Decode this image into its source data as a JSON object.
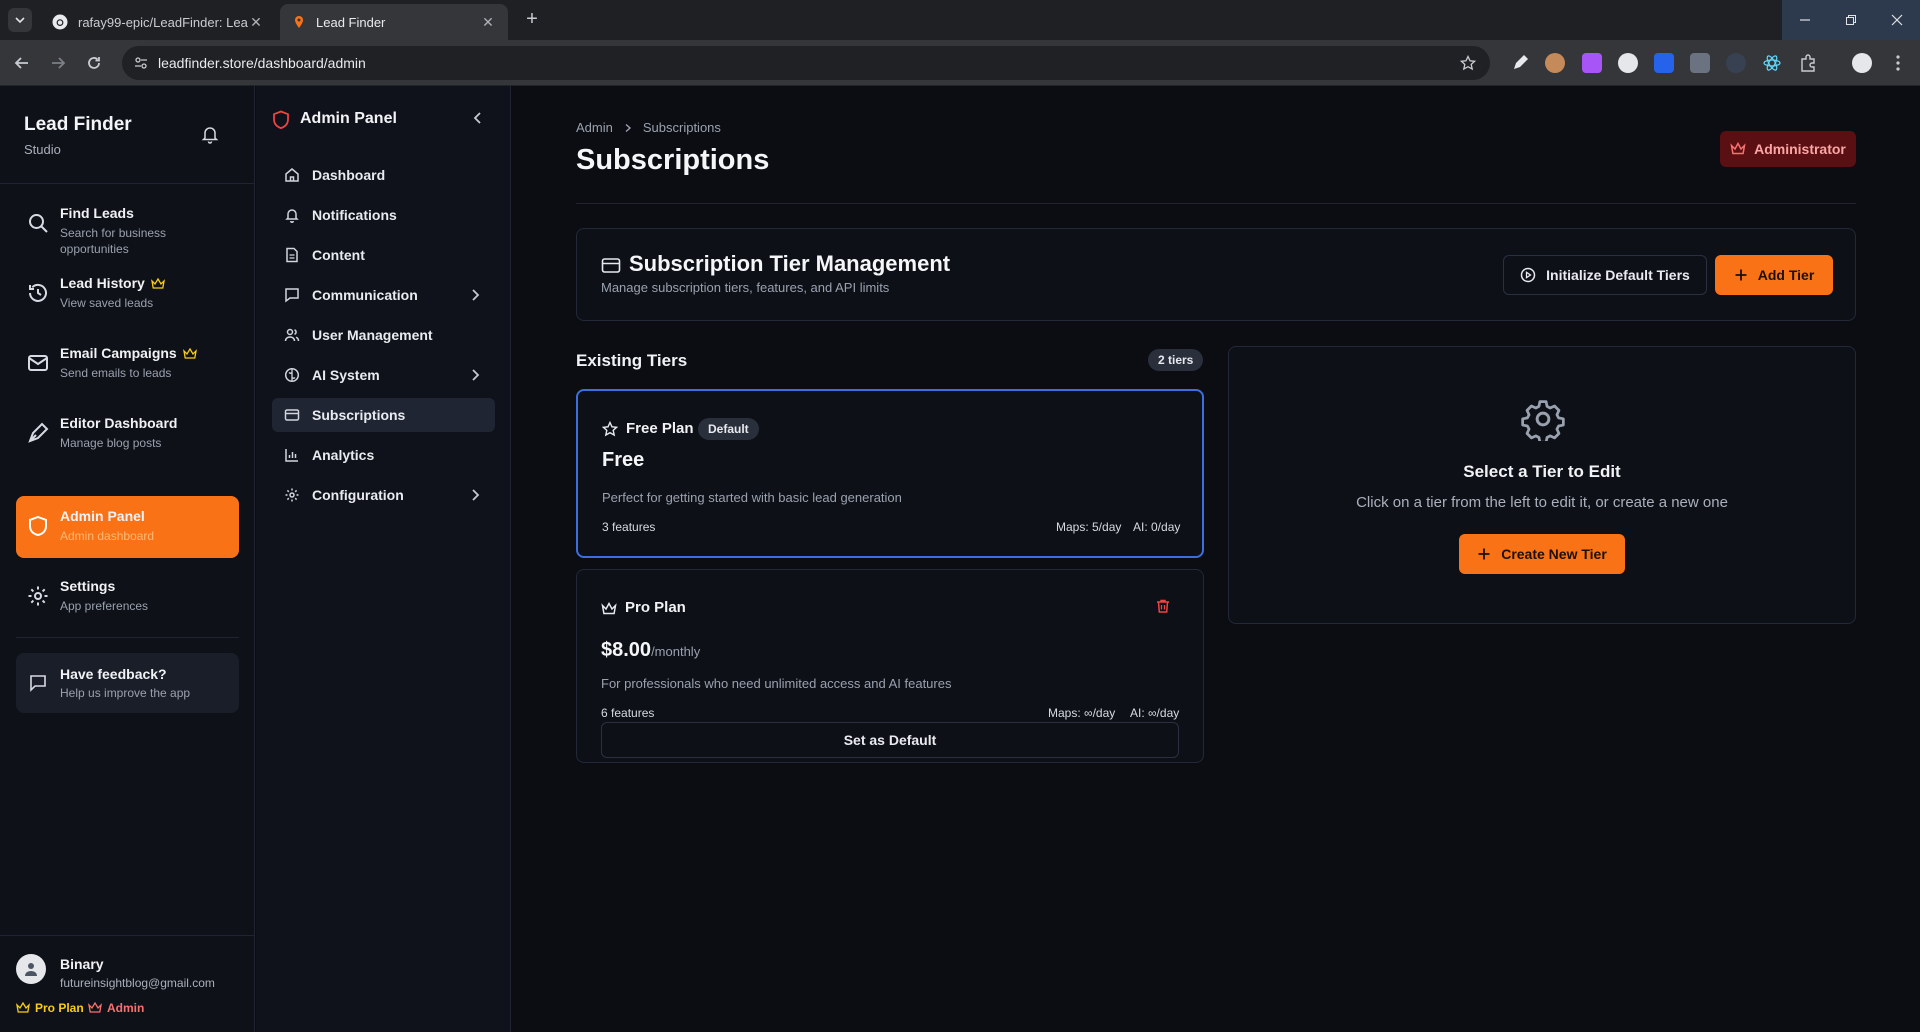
{
  "browser": {
    "tabs": [
      {
        "title": "rafay99-epic/LeadFinder: Lead"
      },
      {
        "title": "Lead Finder"
      }
    ],
    "url": "leadfinder.store/dashboard/admin"
  },
  "sidebar": {
    "brand": {
      "title": "Lead Finder",
      "subtitle": "Studio"
    },
    "items": [
      {
        "title": "Find Leads",
        "subtitle": "Search for business opportunities",
        "icon": "search-icon"
      },
      {
        "title": "Lead History",
        "subtitle": "View saved leads",
        "icon": "history-icon",
        "premium": true
      },
      {
        "title": "Email Campaigns",
        "subtitle": "Send emails to leads",
        "icon": "mail-icon",
        "premium": true
      },
      {
        "title": "Editor Dashboard",
        "subtitle": "Manage blog posts",
        "icon": "pen-icon"
      },
      {
        "title": "Admin Panel",
        "subtitle": "Admin dashboard",
        "icon": "shield-icon",
        "active": true
      },
      {
        "title": "Settings",
        "subtitle": "App preferences",
        "icon": "gear-icon"
      }
    ],
    "feedback": {
      "title": "Have feedback?",
      "subtitle": "Help us improve the app"
    },
    "user": {
      "name": "Binary",
      "email": "futureinsightblog@gmail.com",
      "plan_label": "Pro Plan",
      "role_label": "Admin"
    }
  },
  "subnav": {
    "title": "Admin Panel",
    "items": [
      {
        "label": "Dashboard"
      },
      {
        "label": "Notifications"
      },
      {
        "label": "Content"
      },
      {
        "label": "Communication",
        "has_children": true
      },
      {
        "label": "User Management"
      },
      {
        "label": "AI System",
        "has_children": true
      },
      {
        "label": "Subscriptions",
        "active": true
      },
      {
        "label": "Analytics"
      },
      {
        "label": "Configuration",
        "has_children": true
      }
    ]
  },
  "main": {
    "breadcrumb": [
      "Admin",
      "Subscriptions"
    ],
    "title": "Subscriptions",
    "role_badge": "Administrator",
    "tier_mgmt": {
      "title": "Subscription Tier Management",
      "subtitle": "Manage subscription tiers, features, and API limits",
      "init_button": "Initialize Default Tiers",
      "add_button": "Add Tier"
    },
    "existing": {
      "title": "Existing Tiers",
      "count_badge": "2 tiers",
      "tiers": [
        {
          "name": "Free Plan",
          "badge": "Default",
          "price": "Free",
          "period": "",
          "description": "Perfect for getting started with basic lead generation",
          "features": "3 features",
          "maps": "Maps: 5/day",
          "ai": "AI: 0/day",
          "selected": true
        },
        {
          "name": "Pro Plan",
          "price": "$8.00",
          "period": "/monthly",
          "description": "For professionals who need unlimited access and AI features",
          "features": "6 features",
          "maps": "Maps: ∞/day",
          "ai": "AI: ∞/day",
          "default_button": "Set as Default"
        }
      ]
    },
    "editor_empty": {
      "title": "Select a Tier to Edit",
      "text": "Click on a tier from the left to edit it, or create a new one",
      "button": "Create New Tier"
    }
  },
  "colors": {
    "accent": "#f97316",
    "selected_border": "#3b6fe0",
    "danger": "#ef4444",
    "gold": "#facc15"
  }
}
